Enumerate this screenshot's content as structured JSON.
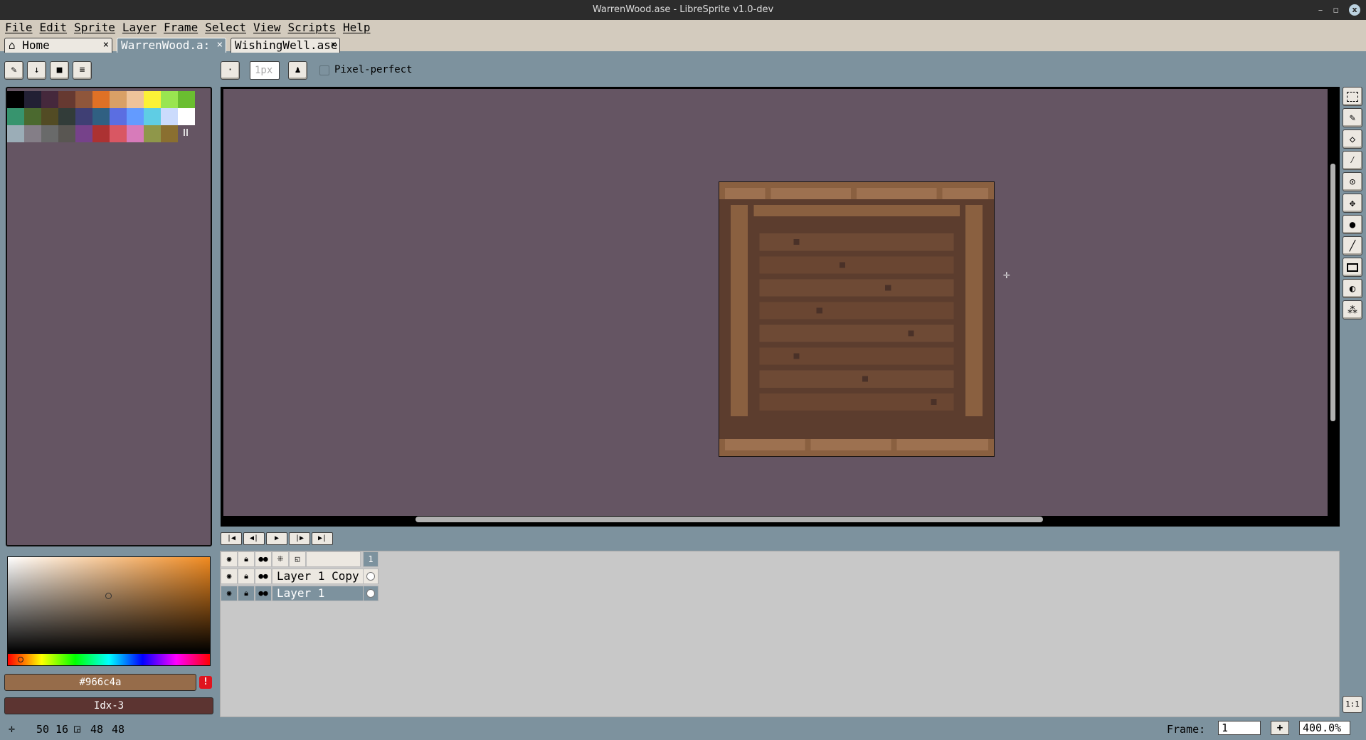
{
  "window": {
    "title": "WarrenWood.ase - LibreSprite v1.0-dev",
    "minimize": "–",
    "restore": "▫",
    "close": "x"
  },
  "menu": [
    "File",
    "Edit",
    "Sprite",
    "Layer",
    "Frame",
    "Select",
    "View",
    "Scripts",
    "Help"
  ],
  "tabs": [
    {
      "label": "Home",
      "icon": "home-icon",
      "close": "×"
    },
    {
      "label": "WarrenWood.a:",
      "close": "×"
    },
    {
      "label": "WishingWell.ase",
      "close": "×"
    }
  ],
  "toolbar": {
    "brush_size_placeholder": "1px",
    "pixel_perfect_label": "Pixel-perfect"
  },
  "palette": {
    "colors": [
      "#000000",
      "#222034",
      "#45283c",
      "#663931",
      "#8f563b",
      "#df7126",
      "#d9a066",
      "#eec39a",
      "#fbf236",
      "#99e550",
      "#6abe30",
      "#37946e",
      "#4b692f",
      "#524b24",
      "#323c39",
      "#3f3f74",
      "#306082",
      "#5b6ee1",
      "#639bff",
      "#5fcde4",
      "#cbdbfc",
      "#ffffff",
      "#9badb7",
      "#847e87",
      "#696a6a",
      "#595652",
      "#76428a",
      "#ac3232",
      "#d95763",
      "#d77bba",
      "#8f974a",
      "#8a6f30"
    ]
  },
  "colors": {
    "foreground_label": "#966c4a",
    "background_label": "Idx-3",
    "warning": "!",
    "accent": "#966c4a"
  },
  "timeline": {
    "frame_header": "1",
    "layers": [
      {
        "name": "Layer 1 Copy"
      },
      {
        "name": "Layer 1"
      }
    ]
  },
  "status": {
    "cursor_x": "50",
    "cursor_y": "16",
    "sel_w": "48",
    "sel_h": "48",
    "frame_label": "Frame:",
    "frame_value": "1",
    "frame_add": "+",
    "zoom": "400.0%",
    "one_to_one": "1:1"
  }
}
